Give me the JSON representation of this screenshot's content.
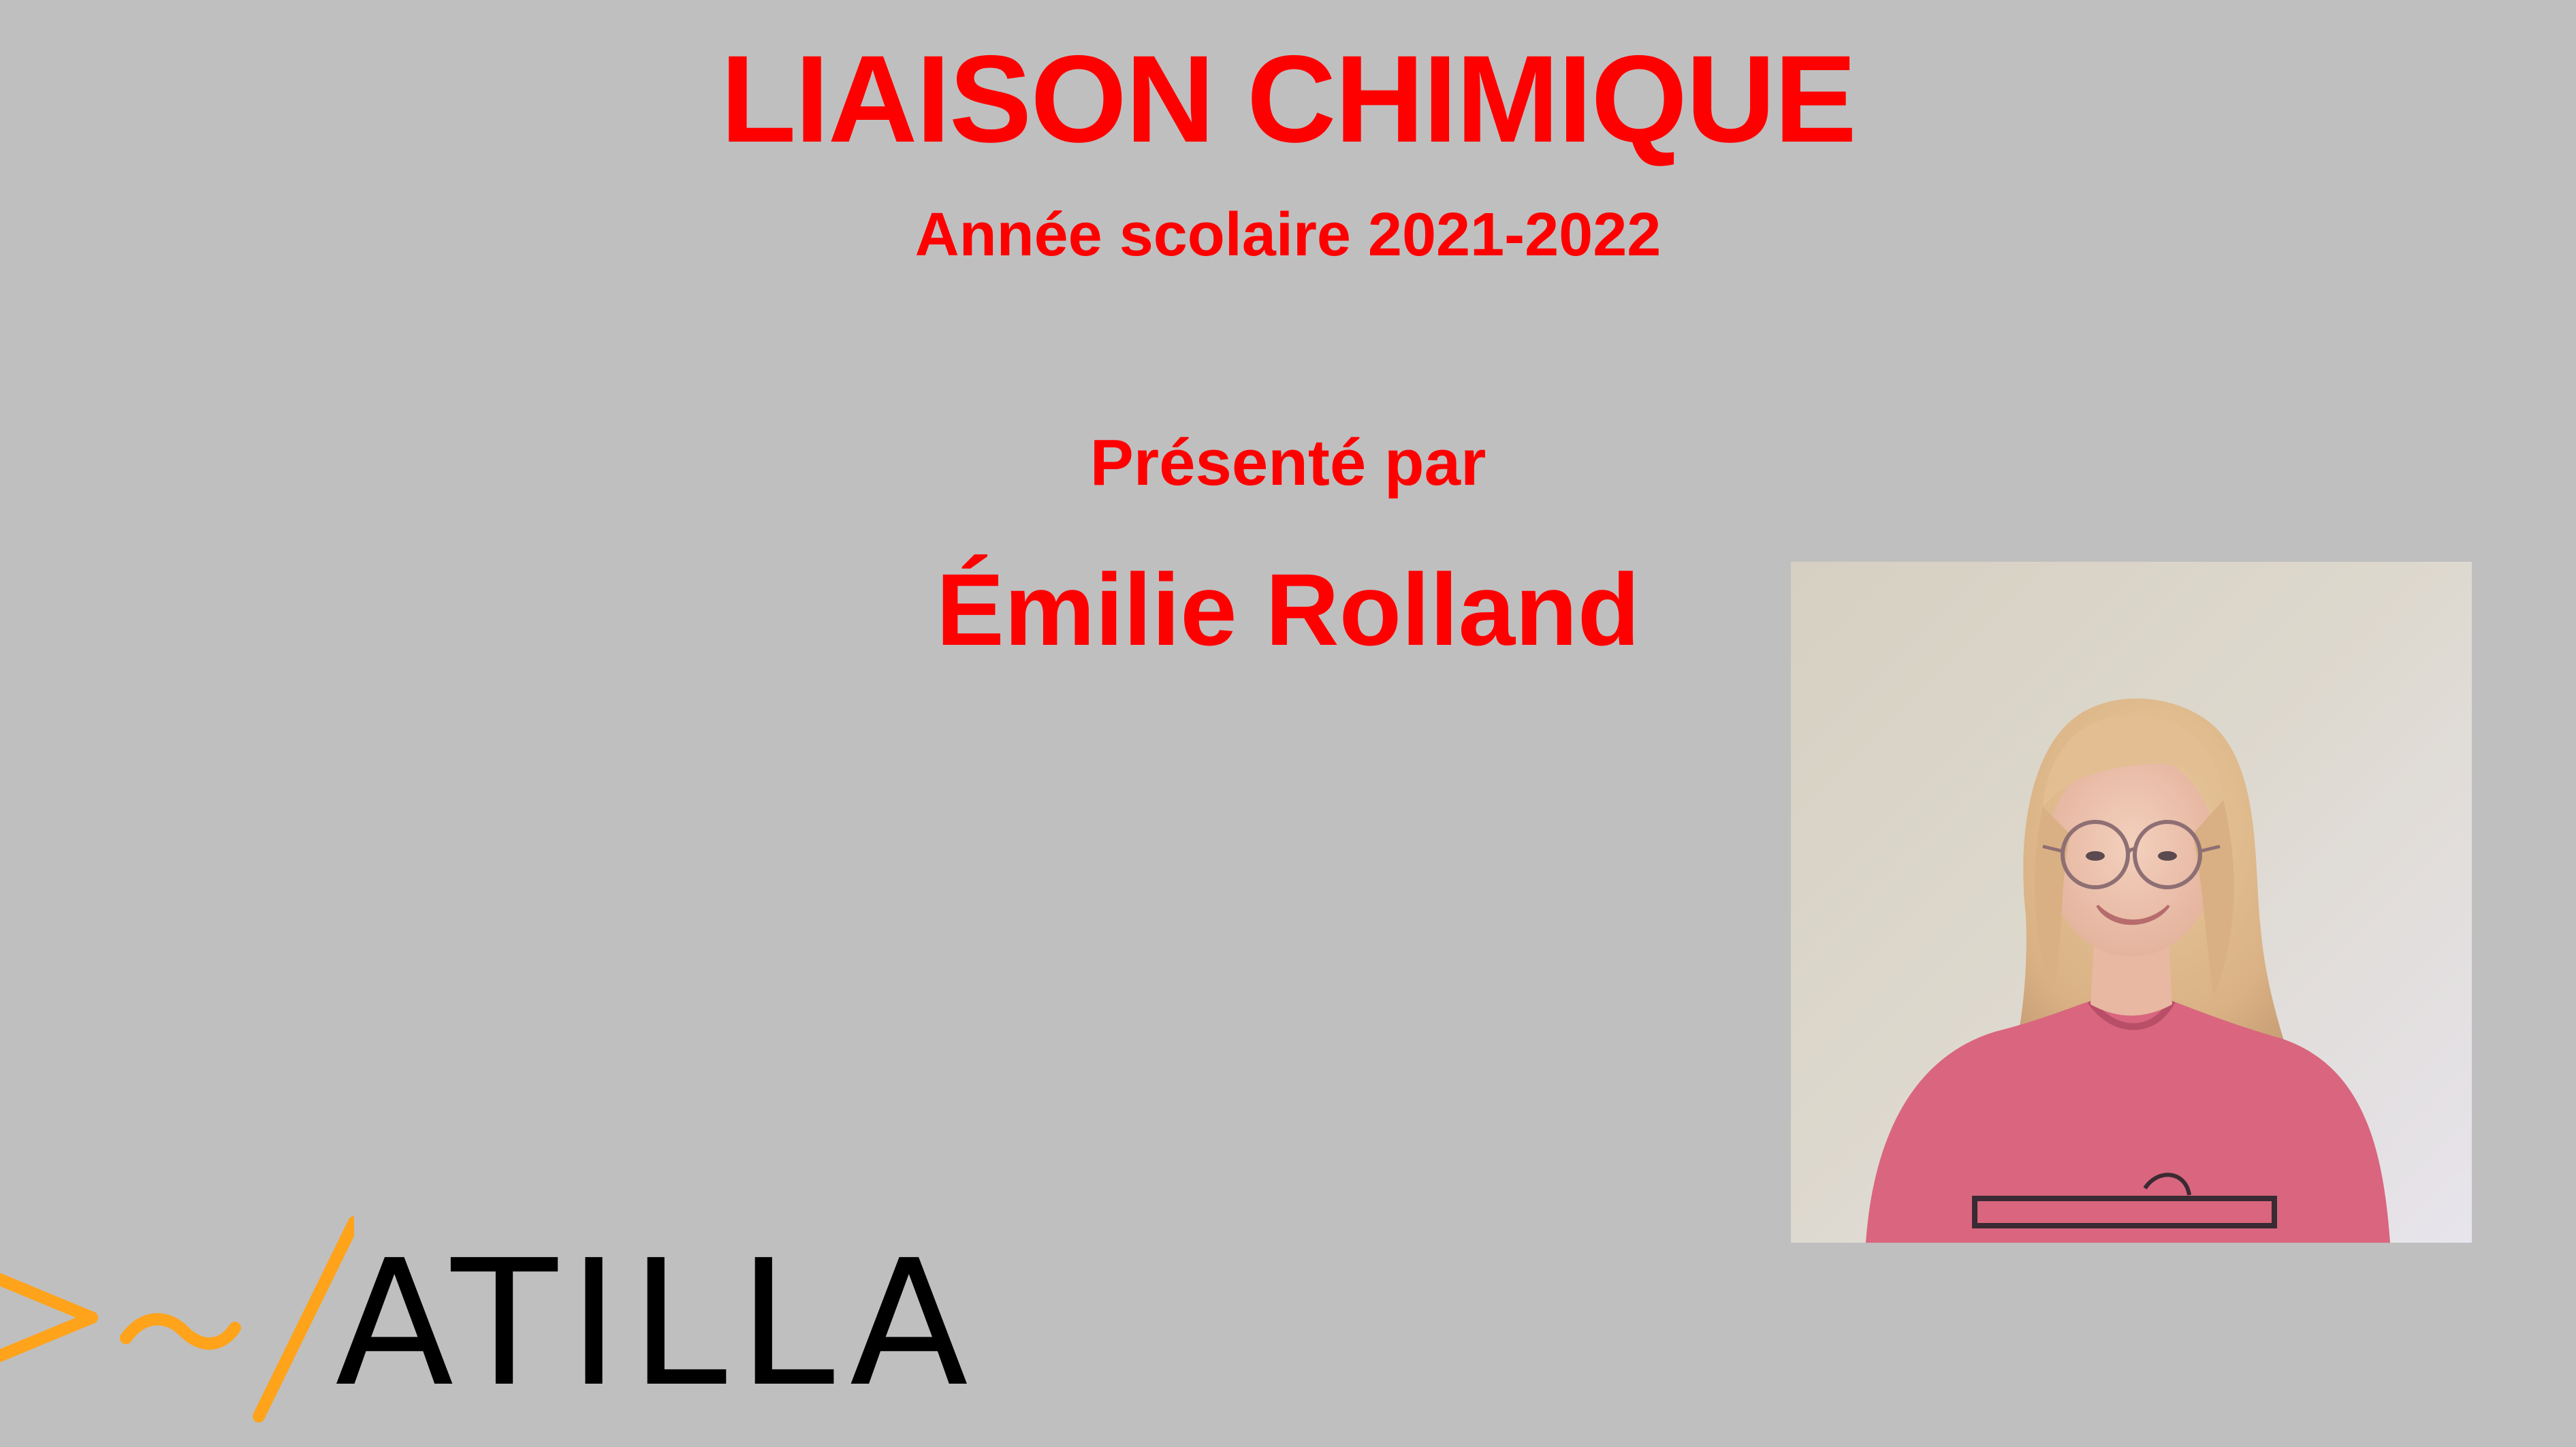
{
  "slide": {
    "title": "LIAISON CHIMIQUE",
    "subtitle": "Année scolaire 2021-2022",
    "presented_by": "Présenté par",
    "presenter_name": "Émilie Rolland"
  },
  "logo": {
    "wordmark": "ATILLA",
    "symbol": ">~/",
    "symbol_color": "#ffa31a",
    "text_color": "#000000"
  },
  "colors": {
    "background": "#bfbfbf",
    "accent": "#ff0000"
  }
}
